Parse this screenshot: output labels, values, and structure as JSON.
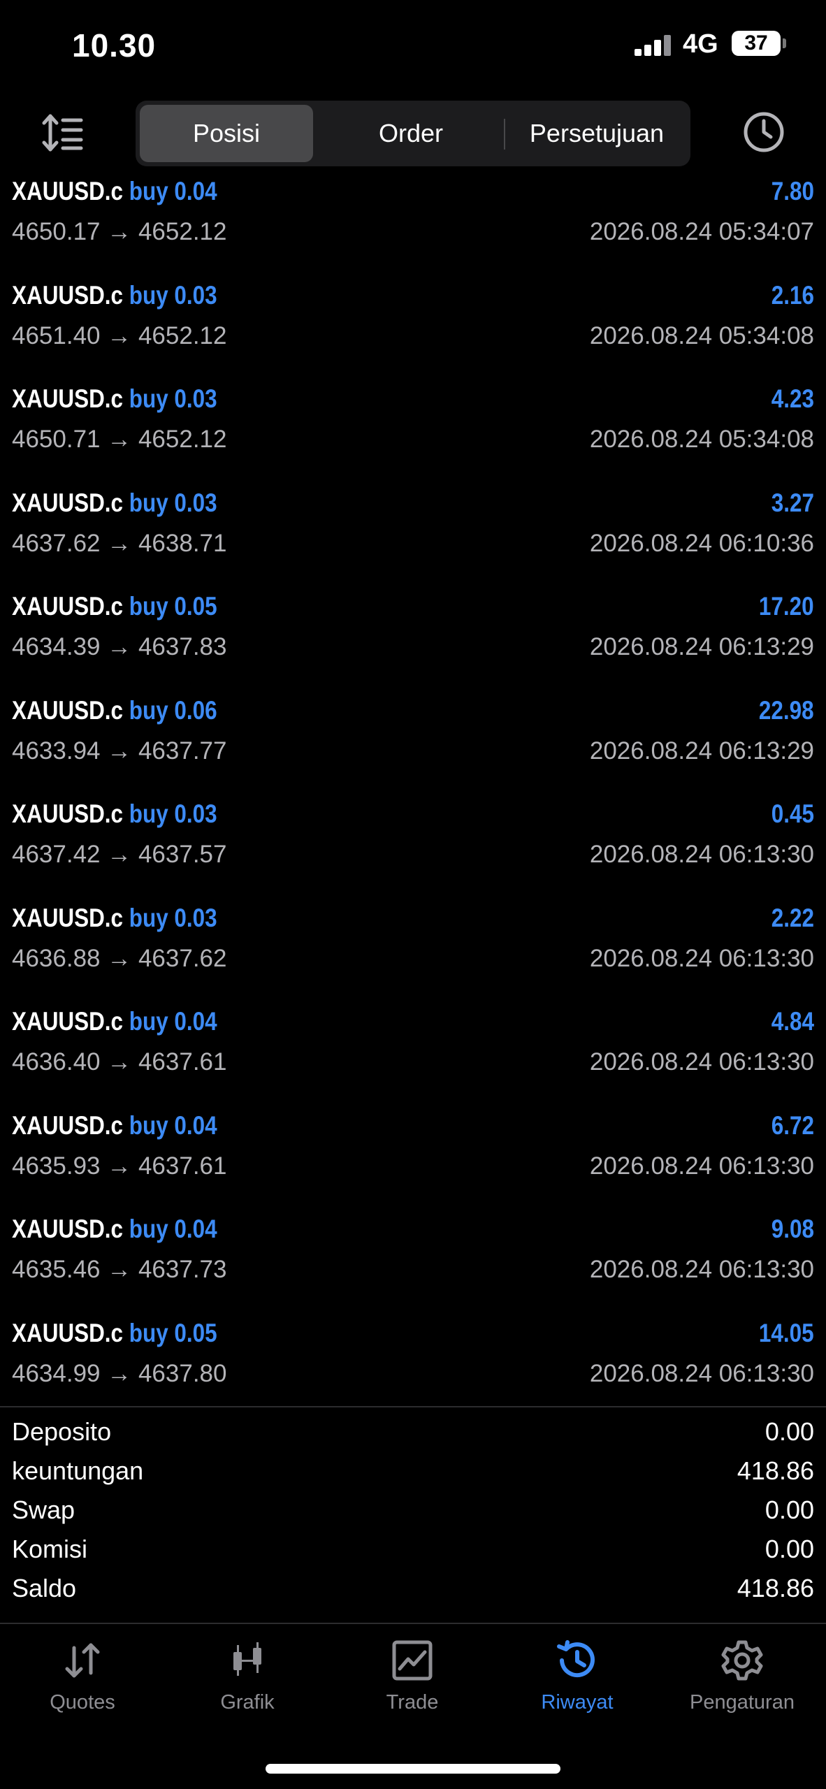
{
  "status_bar": {
    "time": "10.30",
    "network": "4G",
    "battery": "37"
  },
  "tabs": [
    {
      "label": "Posisi",
      "active": true
    },
    {
      "label": "Order",
      "active": false
    },
    {
      "label": "Persetujuan",
      "active": false
    }
  ],
  "trades": [
    {
      "symbol": "XAUUSD.c",
      "side": "buy 0.04",
      "profit": "7.80",
      "prices": "4650.17 → 4652.12",
      "datetime": "2026.08.24 05:34:07"
    },
    {
      "symbol": "XAUUSD.c",
      "side": "buy 0.03",
      "profit": "2.16",
      "prices": "4651.40 → 4652.12",
      "datetime": "2026.08.24 05:34:08"
    },
    {
      "symbol": "XAUUSD.c",
      "side": "buy 0.03",
      "profit": "4.23",
      "prices": "4650.71 → 4652.12",
      "datetime": "2026.08.24 05:34:08"
    },
    {
      "symbol": "XAUUSD.c",
      "side": "buy 0.03",
      "profit": "3.27",
      "prices": "4637.62 → 4638.71",
      "datetime": "2026.08.24 06:10:36"
    },
    {
      "symbol": "XAUUSD.c",
      "side": "buy 0.05",
      "profit": "17.20",
      "prices": "4634.39 → 4637.83",
      "datetime": "2026.08.24 06:13:29"
    },
    {
      "symbol": "XAUUSD.c",
      "side": "buy 0.06",
      "profit": "22.98",
      "prices": "4633.94 → 4637.77",
      "datetime": "2026.08.24 06:13:29"
    },
    {
      "symbol": "XAUUSD.c",
      "side": "buy 0.03",
      "profit": "0.45",
      "prices": "4637.42 → 4637.57",
      "datetime": "2026.08.24 06:13:30"
    },
    {
      "symbol": "XAUUSD.c",
      "side": "buy 0.03",
      "profit": "2.22",
      "prices": "4636.88 → 4637.62",
      "datetime": "2026.08.24 06:13:30"
    },
    {
      "symbol": "XAUUSD.c",
      "side": "buy 0.04",
      "profit": "4.84",
      "prices": "4636.40 → 4637.61",
      "datetime": "2026.08.24 06:13:30"
    },
    {
      "symbol": "XAUUSD.c",
      "side": "buy 0.04",
      "profit": "6.72",
      "prices": "4635.93 → 4637.61",
      "datetime": "2026.08.24 06:13:30"
    },
    {
      "symbol": "XAUUSD.c",
      "side": "buy 0.04",
      "profit": "9.08",
      "prices": "4635.46 → 4637.73",
      "datetime": "2026.08.24 06:13:30"
    },
    {
      "symbol": "XAUUSD.c",
      "side": "buy 0.05",
      "profit": "14.05",
      "prices": "4634.99 → 4637.80",
      "datetime": "2026.08.24 06:13:30"
    }
  ],
  "summary": [
    {
      "label": "Deposito",
      "value": "0.00"
    },
    {
      "label": "keuntungan",
      "value": "418.86"
    },
    {
      "label": "Swap",
      "value": "0.00"
    },
    {
      "label": "Komisi",
      "value": "0.00"
    },
    {
      "label": "Saldo",
      "value": "418.86"
    }
  ],
  "bottom_nav": [
    {
      "label": "Quotes",
      "icon": "quotes-arrows-icon",
      "active": false
    },
    {
      "label": "Grafik",
      "icon": "candlestick-icon",
      "active": false
    },
    {
      "label": "Trade",
      "icon": "trade-chart-icon",
      "active": false
    },
    {
      "label": "Riwayat",
      "icon": "history-clock-icon",
      "active": true
    },
    {
      "label": "Pengaturan",
      "icon": "gear-icon",
      "active": false
    }
  ],
  "colors": {
    "accent": "#3d8bf5",
    "background": "#000000",
    "muted_text": "#b4b4b8",
    "inactive_tab": "#8e8e93"
  }
}
